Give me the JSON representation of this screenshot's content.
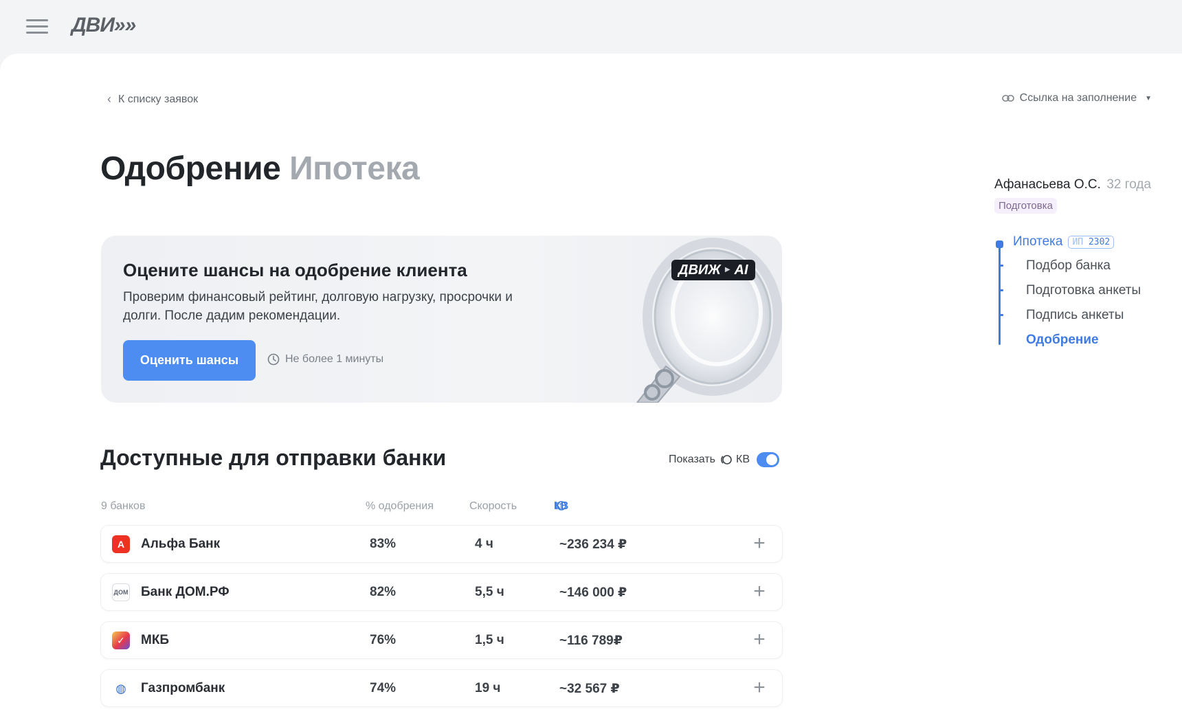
{
  "header": {
    "logo_text": "ДВИ»»",
    "menu_icon": "hamburger-icon"
  },
  "nav": {
    "back_label": "К списку заявок",
    "share_label": "Ссылка на заполнение"
  },
  "page": {
    "title_main": "Одобрение",
    "title_sub": "Ипотека"
  },
  "promo": {
    "title": "Оцените шансы на одобрение клиента",
    "description": "Проверим финансовый рейтинг, долговую нагрузку, просрочки и долги. После дадим рекомендации.",
    "button_label": "Оценить шансы",
    "hint": "Не более 1 минуты",
    "badge_left": "ДВИЖ",
    "badge_right": "AI"
  },
  "banks": {
    "title": "Доступные для отправки банки",
    "toggle_label": "Показать",
    "toggle_kv": "КВ",
    "toggle_on": true,
    "count_label": "9 банков",
    "col_approval": "% одобрения",
    "col_speed": "Скорость",
    "col_kv": "КВ",
    "rows": [
      {
        "name": "Альфа Банк",
        "approval": "83%",
        "speed": "4 ч",
        "kv": "~236 234 ₽",
        "icon": "alfa-bank-icon",
        "color": "#ef3124",
        "glyph": "А"
      },
      {
        "name": "Банк ДОМ.РФ",
        "approval": "82%",
        "speed": "5,5 ч",
        "kv": "~146 000 ₽",
        "icon": "dom-rf-icon",
        "color": "#ffffff",
        "glyph": "ДОМ"
      },
      {
        "name": "МКБ",
        "approval": "76%",
        "speed": "1,5 ч",
        "kv": "~116 789₽",
        "icon": "mkb-icon",
        "color": "#e8394b",
        "glyph": "✓"
      },
      {
        "name": "Газпромбанк",
        "approval": "74%",
        "speed": "19 ч",
        "kv": "~32 567 ₽",
        "icon": "gazprombank-icon",
        "color": "#ffffff",
        "glyph": "◍"
      }
    ]
  },
  "client": {
    "name": "Афанасьева О.С.",
    "age": "32 года",
    "status": "Подготовка"
  },
  "steps": {
    "head_label": "Ипотека",
    "tag_prefix": "ИП",
    "tag_number": "2302",
    "items": [
      "Подбор банка",
      "Подготовка анкеты",
      "Подпись анкеты",
      "Одобрение"
    ]
  },
  "colors": {
    "accent": "#4d8cf0",
    "link": "#3f7be0",
    "muted": "#a4a9b0"
  }
}
